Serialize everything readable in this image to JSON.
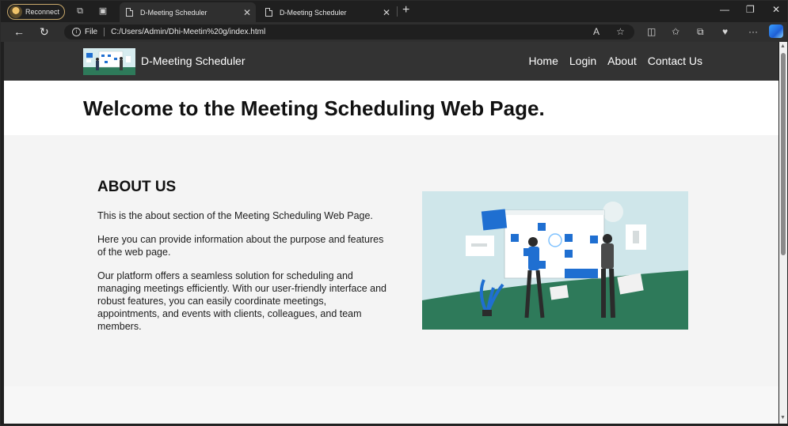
{
  "browser": {
    "profile_label": "Reconnect",
    "tabs": [
      {
        "title": "D-Meeting Scheduler",
        "active": true
      },
      {
        "title": "D-Meeting Scheduler",
        "active": false
      }
    ],
    "url_prefix": "File",
    "url": "C:/Users/Admin/Dhi-Meetin%20g/index.html",
    "icons": [
      "read-aloud-icon",
      "favorite-star-icon",
      "split-screen-icon",
      "favorites-icon",
      "collections-icon",
      "browser-essentials-icon",
      "more-icon",
      "copilot-icon"
    ]
  },
  "site": {
    "title": "D-Meeting Scheduler",
    "nav": [
      "Home",
      "Login",
      "About",
      "Contact Us"
    ],
    "header_bg": "#333333"
  },
  "hero": {
    "heading": "Welcome to the Meeting Scheduling Web Page."
  },
  "about": {
    "heading": "ABOUT US",
    "paragraphs": [
      "This is the about section of the Meeting Scheduling Web Page.",
      "Here you can provide information about the purpose and features of the web page.",
      "Our platform offers a seamless solution for scheduling and managing meetings efficiently. With our user-friendly interface and robust features, you can easily coordinate meetings, appointments, and events with clients, colleagues, and team members."
    ]
  },
  "colors": {
    "accent_blue": "#1f6fd1",
    "ground_green": "#2e7a5a",
    "illustration_bg": "#cfe6ea"
  }
}
